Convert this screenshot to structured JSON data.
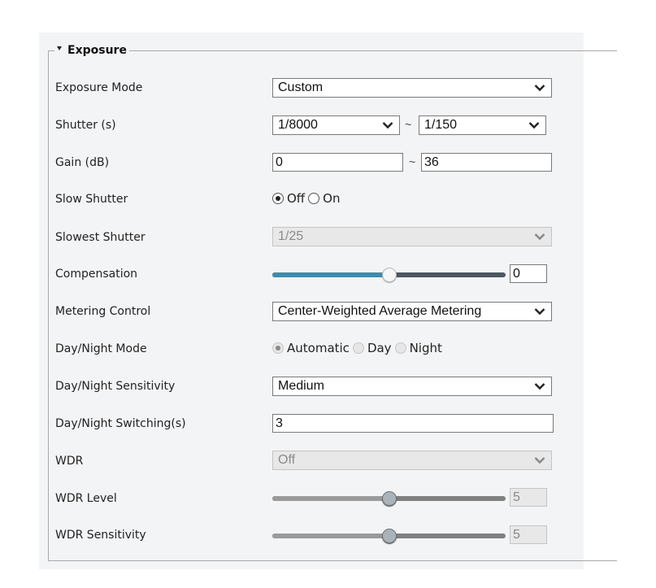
{
  "section": {
    "title": "Exposure",
    "expanded": true
  },
  "colors": {
    "panel_bg": "#f3f4f6",
    "slider_fill": "#3e8cad",
    "slider_track": "#4c5862"
  },
  "fields": {
    "exposure_mode": {
      "label": "Exposure Mode",
      "value": "Custom"
    },
    "shutter": {
      "label": "Shutter (s)",
      "min": "1/8000",
      "max": "1/150",
      "separator": "~"
    },
    "gain": {
      "label": "Gain (dB)",
      "min": "0",
      "max": "36",
      "separator": "~"
    },
    "slow_shutter": {
      "label": "Slow Shutter",
      "options": [
        "Off",
        "On"
      ],
      "selected": "Off"
    },
    "slowest_shutter": {
      "label": "Slowest Shutter",
      "value": "1/25",
      "disabled": true
    },
    "compensation": {
      "label": "Compensation",
      "value": "0",
      "slider_fraction": 0.5
    },
    "metering_control": {
      "label": "Metering Control",
      "value": "Center-Weighted Average Metering"
    },
    "day_night_mode": {
      "label": "Day/Night Mode",
      "options": [
        "Automatic",
        "Day",
        "Night"
      ],
      "selected": "Automatic"
    },
    "day_night_sensitivity": {
      "label": "Day/Night Sensitivity",
      "value": "Medium"
    },
    "day_night_switching": {
      "label": "Day/Night Switching(s)",
      "value": "3"
    },
    "wdr": {
      "label": "WDR",
      "value": "Off",
      "disabled": true
    },
    "wdr_level": {
      "label": "WDR Level",
      "value": "5",
      "slider_fraction": 0.5,
      "disabled": true
    },
    "wdr_sensitivity": {
      "label": "WDR Sensitivity",
      "value": "5",
      "slider_fraction": 0.5,
      "disabled": true
    }
  }
}
